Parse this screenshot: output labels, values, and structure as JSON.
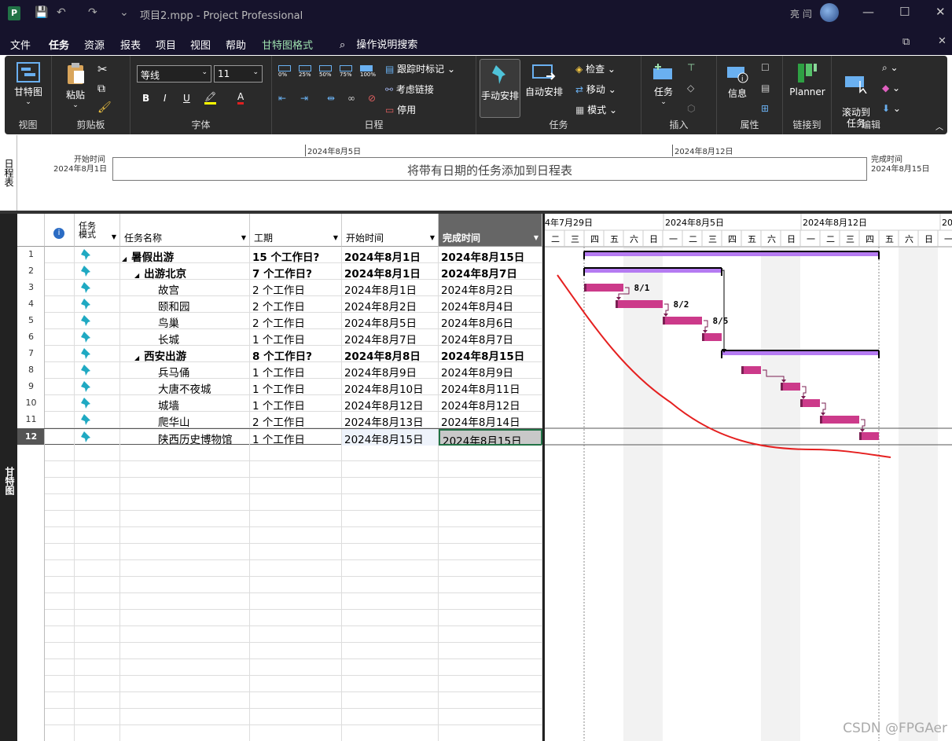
{
  "title_bar": {
    "title": "项目2.mpp  -  Project Professional",
    "user": "亮 闫"
  },
  "menu": {
    "tabs": [
      "文件",
      "任务",
      "资源",
      "报表",
      "项目",
      "视图",
      "帮助",
      "甘特图格式"
    ],
    "active": "任务",
    "search": "操作说明搜索"
  },
  "ribbon": {
    "view_group": {
      "label": "视图",
      "btn": "甘特图"
    },
    "clipboard": {
      "label": "剪贴板",
      "paste": "粘贴"
    },
    "font": {
      "label": "字体",
      "family": "等线",
      "size": "11",
      "bold": "B",
      "italic": "I",
      "underline": "U"
    },
    "schedule": {
      "label": "日程",
      "pcts": [
        "0%",
        "25%",
        "50%",
        "75%",
        "100%"
      ],
      "track": "跟踪时标记",
      "respect": "考虑链接",
      "inactivate": "停用"
    },
    "tasks": {
      "label": "任务",
      "manual": "手动安排",
      "auto": "自动安排",
      "inspect": "检查",
      "move": "移动",
      "mode": "模式"
    },
    "insert": {
      "label": "插入",
      "task": "任务"
    },
    "properties": {
      "label": "属性",
      "info": "信息"
    },
    "link": {
      "label": "链接到",
      "planner": "Planner"
    },
    "edit": {
      "label": "编辑",
      "scroll": "滚动到\n任务"
    }
  },
  "timeline": {
    "side_label": "日程表",
    "start_label": "开始时间",
    "start_date": "2024年8月1日",
    "end_label": "完成时间",
    "end_date": "2024年8月15日",
    "mid1": "2024年8月5日",
    "mid2": "2024年8月12日",
    "placeholder": "将带有日期的任务添加到日程表"
  },
  "grid": {
    "side_label": "甘特图",
    "headers": {
      "mode": "任务\n模式",
      "name": "任务名称",
      "duration": "工期",
      "start": "开始时间",
      "finish": "完成时间"
    },
    "rows": [
      {
        "id": "1",
        "name": "暑假出游",
        "duration": "15 个工作日?",
        "start": "2024年8月1日",
        "finish": "2024年8月15日",
        "level": 0,
        "summary": true
      },
      {
        "id": "2",
        "name": "出游北京",
        "duration": "7 个工作日?",
        "start": "2024年8月1日",
        "finish": "2024年8月7日",
        "level": 1,
        "summary": true
      },
      {
        "id": "3",
        "name": "故宫",
        "duration": "2 个工作日",
        "start": "2024年8月1日",
        "finish": "2024年8月2日",
        "level": 2,
        "summary": false
      },
      {
        "id": "4",
        "name": "颐和园",
        "duration": "2 个工作日",
        "start": "2024年8月2日",
        "finish": "2024年8月4日",
        "level": 2,
        "summary": false
      },
      {
        "id": "5",
        "name": "鸟巢",
        "duration": "2 个工作日",
        "start": "2024年8月5日",
        "finish": "2024年8月6日",
        "level": 2,
        "summary": false
      },
      {
        "id": "6",
        "name": "长城",
        "duration": "1 个工作日",
        "start": "2024年8月7日",
        "finish": "2024年8月7日",
        "level": 2,
        "summary": false
      },
      {
        "id": "7",
        "name": "西安出游",
        "duration": "8 个工作日?",
        "start": "2024年8月8日",
        "finish": "2024年8月15日",
        "level": 1,
        "summary": true
      },
      {
        "id": "8",
        "name": "兵马俑",
        "duration": "1 个工作日",
        "start": "2024年8月9日",
        "finish": "2024年8月9日",
        "level": 2,
        "summary": false
      },
      {
        "id": "9",
        "name": "大唐不夜城",
        "duration": "1 个工作日",
        "start": "2024年8月10日",
        "finish": "2024年8月11日",
        "level": 2,
        "summary": false
      },
      {
        "id": "10",
        "name": "城墙",
        "duration": "1 个工作日",
        "start": "2024年8月12日",
        "finish": "2024年8月12日",
        "level": 2,
        "summary": false
      },
      {
        "id": "11",
        "name": "爬华山",
        "duration": "2 个工作日",
        "start": "2024年8月13日",
        "finish": "2024年8月14日",
        "level": 2,
        "summary": false
      },
      {
        "id": "12",
        "name": "陕西历史博物馆",
        "duration": "1 个工作日",
        "start": "2024年8月15日",
        "finish": "2024年8月15日",
        "level": 2,
        "summary": false
      }
    ]
  },
  "gantt": {
    "weeks": [
      "4年7月29日",
      "2024年8月5日",
      "2024年8月12日",
      "20"
    ],
    "days": [
      "二",
      "三",
      "四",
      "五",
      "六",
      "日",
      "一",
      "二",
      "三",
      "四",
      "五",
      "六",
      "日",
      "一",
      "二",
      "三",
      "四",
      "五",
      "六",
      "日",
      "一"
    ],
    "labels": [
      "8/1",
      "8/2",
      "8/5"
    ]
  },
  "watermark": "CSDN @FPGAer"
}
